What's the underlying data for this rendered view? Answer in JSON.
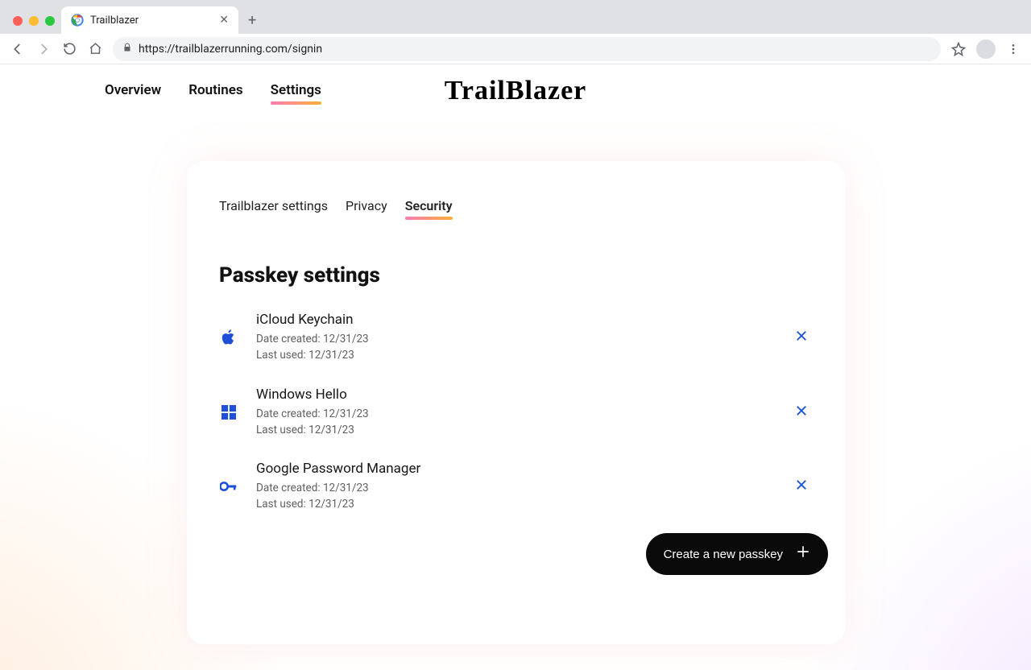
{
  "browser": {
    "tab_title": "Trailblazer",
    "url": "https://trailblazerrunning.com/signin"
  },
  "nav": {
    "items": [
      "Overview",
      "Routines",
      "Settings"
    ],
    "active_index": 2,
    "brand": "TrailBlazer"
  },
  "subnav": {
    "items": [
      "Trailblazer settings",
      "Privacy",
      "Security"
    ],
    "active_index": 2
  },
  "section": {
    "title": "Passkey settings"
  },
  "passkeys": [
    {
      "icon": "apple",
      "name": "iCloud Keychain",
      "created_label": "Date created: 12/31/23",
      "used_label": "Last used: 12/31/23"
    },
    {
      "icon": "windows",
      "name": "Windows Hello",
      "created_label": "Date created: 12/31/23",
      "used_label": "Last used: 12/31/23"
    },
    {
      "icon": "key",
      "name": "Google Password Manager",
      "created_label": "Date created: 12/31/23",
      "used_label": "Last used: 12/31/23"
    }
  ],
  "actions": {
    "create_passkey": "Create a new passkey"
  },
  "colors": {
    "brand_gradient_start": "#ff7ab3",
    "brand_gradient_end": "#ffb039",
    "icon_blue": "#1f4fd8"
  }
}
